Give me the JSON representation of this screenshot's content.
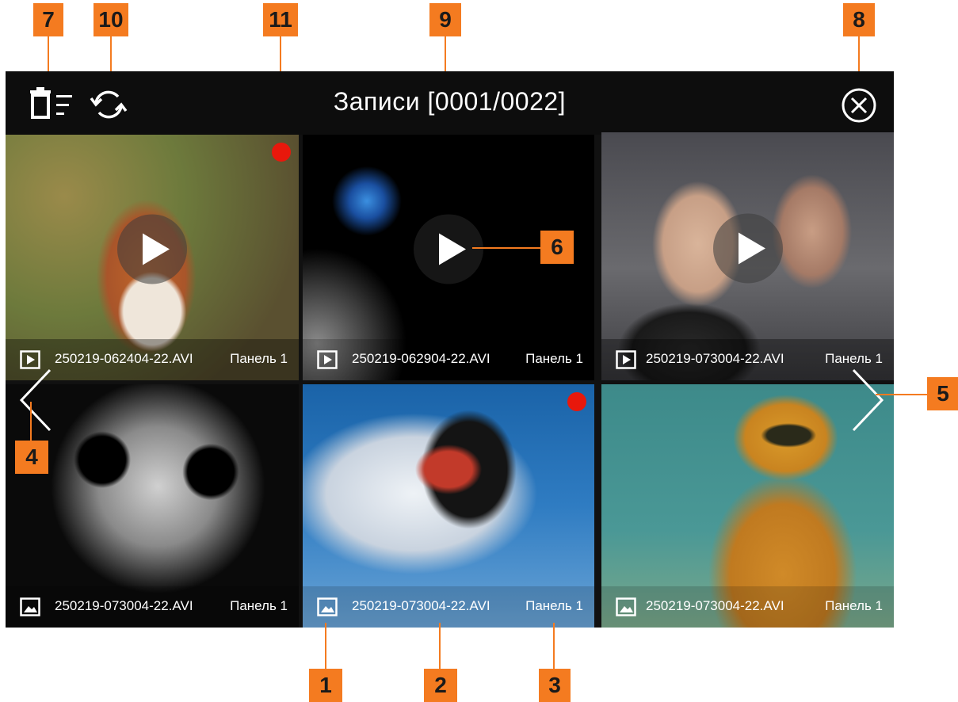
{
  "header": {
    "title": "Записи [0001/0022]",
    "icons": [
      "delete-menu-icon",
      "refresh-icon",
      "close-circle-icon"
    ]
  },
  "tiles": [
    {
      "filename": "250219-062404-22.AVI",
      "panel": "Панель 1",
      "kind": "video",
      "new": true
    },
    {
      "filename": "250219-062904-22.AVI",
      "panel": "Панель 1",
      "kind": "video",
      "new": false
    },
    {
      "filename": "250219-073004-22.AVI",
      "panel": "Панель 1",
      "kind": "video",
      "new": false
    },
    {
      "filename": "250219-073004-22.AVI",
      "panel": "Панель 1",
      "kind": "photo",
      "new": false
    },
    {
      "filename": "250219-073004-22.AVI",
      "panel": "Панель 1",
      "kind": "photo",
      "new": true
    },
    {
      "filename": "250219-073004-22.AVI",
      "panel": "Панель 1",
      "kind": "photo",
      "new": false
    }
  ],
  "callouts": [
    "1",
    "2",
    "3",
    "4",
    "5",
    "6",
    "7",
    "8",
    "9",
    "10",
    "11"
  ],
  "colors": {
    "accent": "#f47b20",
    "record_dot": "#e8180c",
    "background": "#111111"
  }
}
